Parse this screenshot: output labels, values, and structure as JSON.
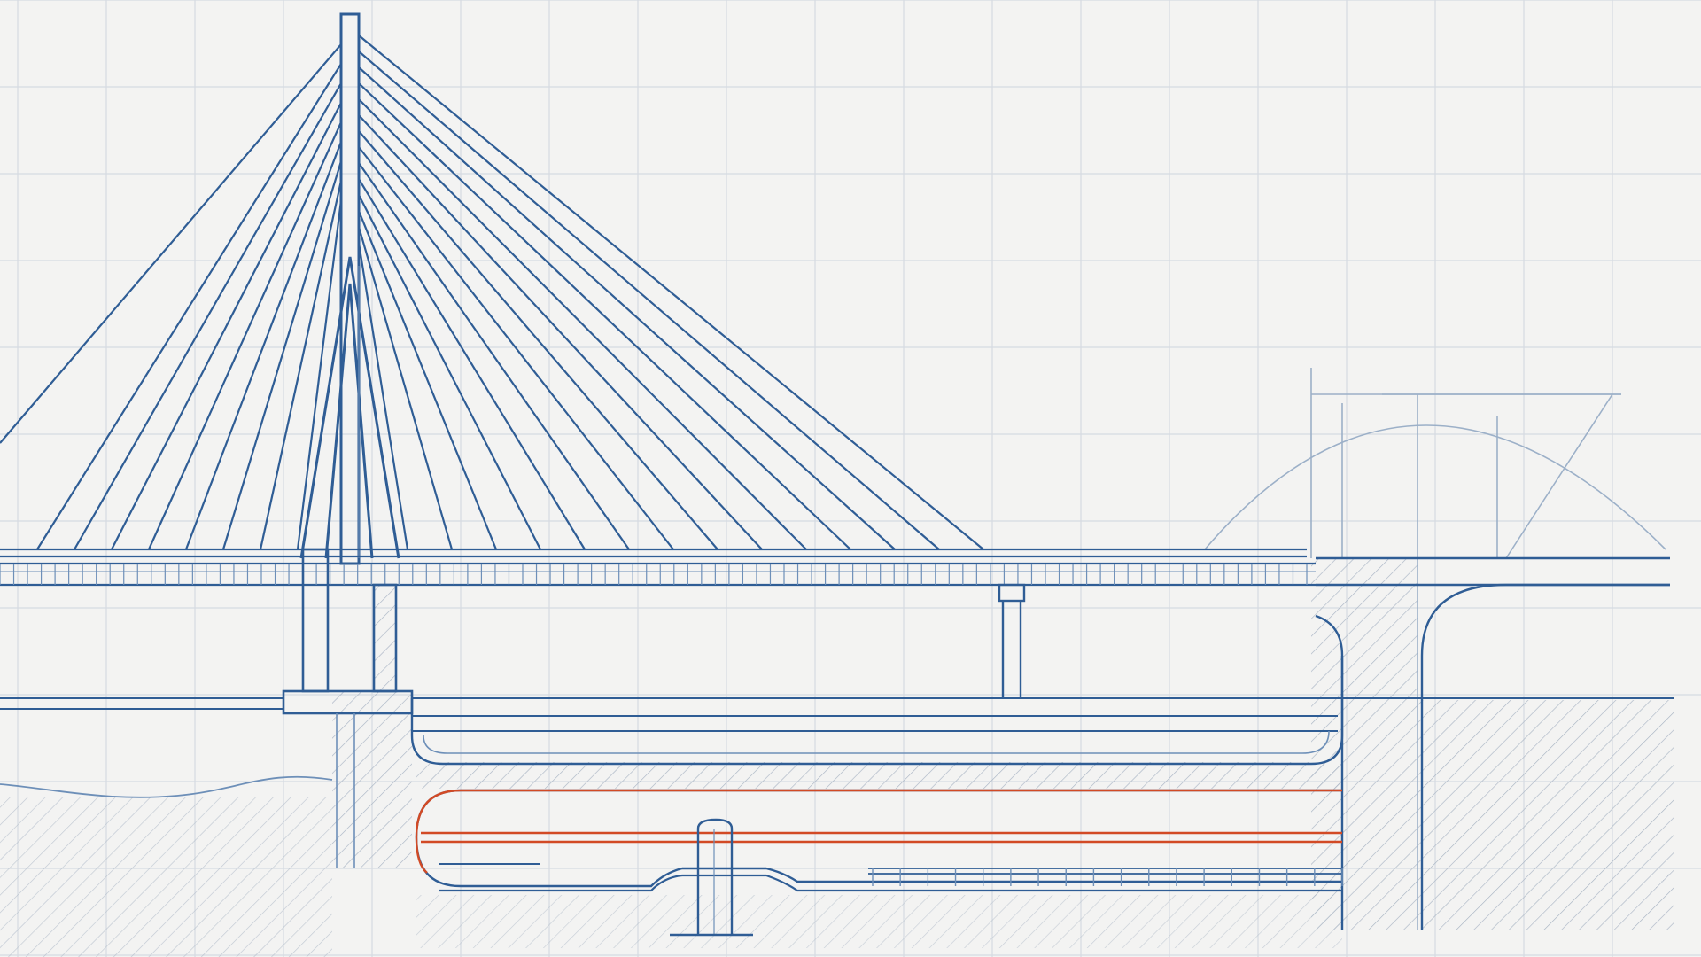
{
  "drawing": {
    "colors": {
      "paper": "#f3f3f2",
      "grid": "#d5dbe2",
      "structure": "#2f5d95",
      "structure_light": "#6d8fb8",
      "accent_pipe": "#d24a25",
      "hatch": "#a9b5c4"
    },
    "stay_cable_count_left": 9,
    "stay_cable_count_right": 14,
    "deck_baluster_count": 95,
    "tunnel_rail_tie_count": 17
  }
}
